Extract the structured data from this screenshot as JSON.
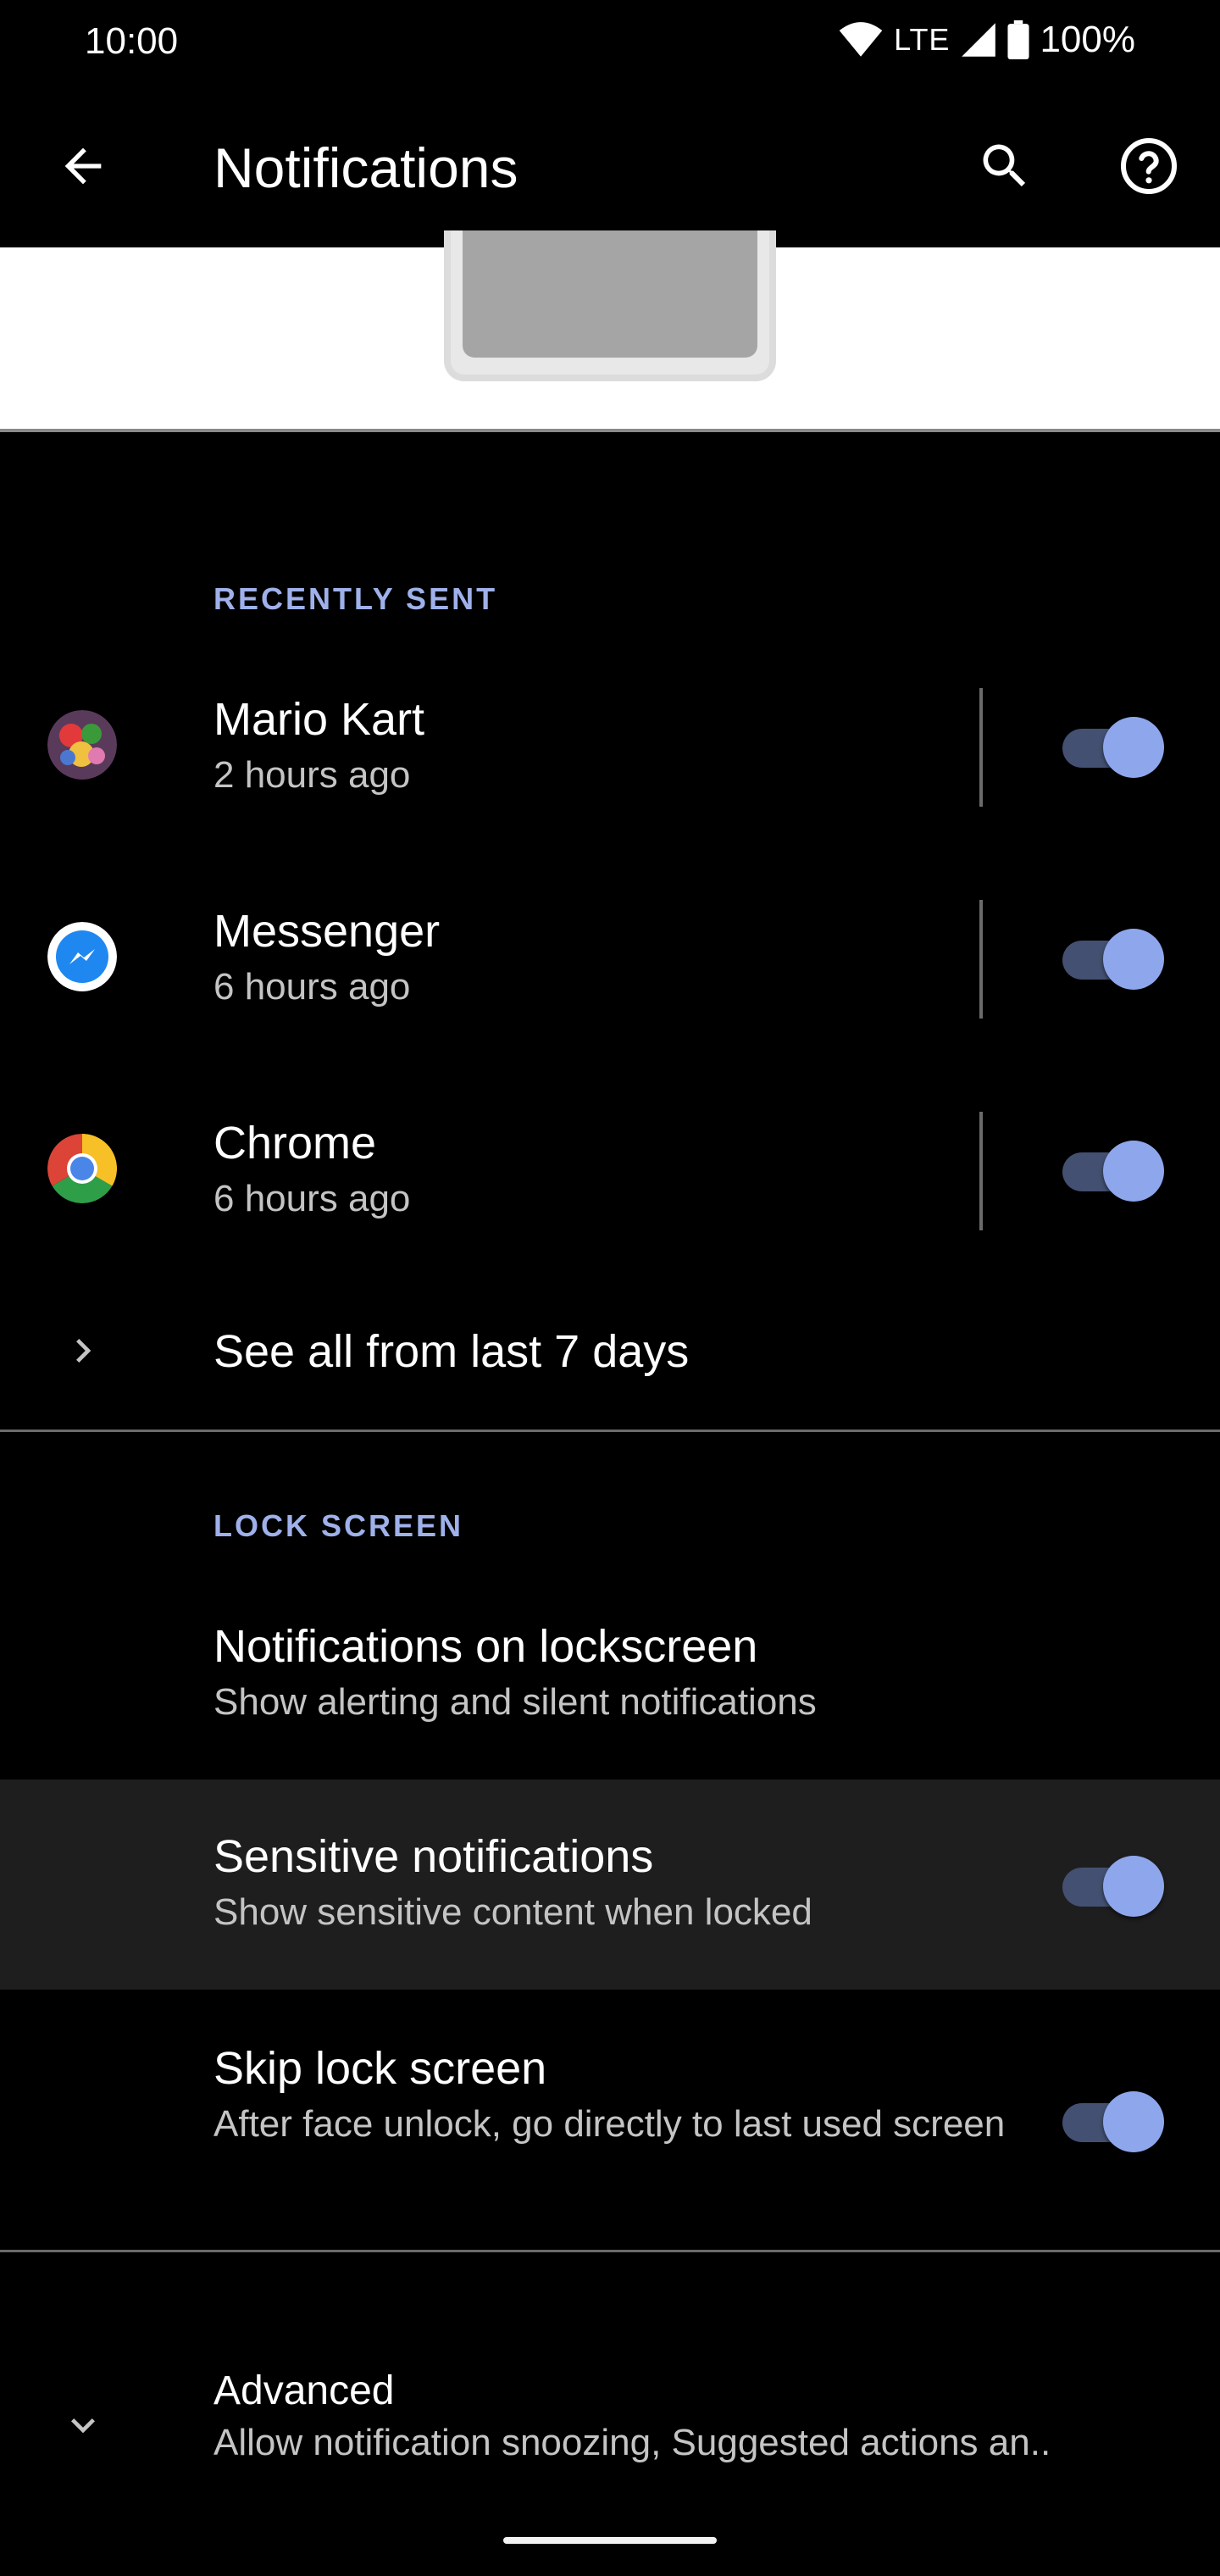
{
  "status_bar": {
    "time": "10:00",
    "network": "LTE",
    "battery": "100%"
  },
  "app_bar": {
    "title": "Notifications",
    "icons": [
      "back-arrow-icon",
      "search-icon",
      "help-icon"
    ]
  },
  "recently_sent": {
    "header": "RECENTLY SENT",
    "apps": [
      {
        "name": "Mario Kart",
        "time": "2 hours ago",
        "enabled": true,
        "icon": "mario-kart-icon"
      },
      {
        "name": "Messenger",
        "time": "6 hours ago",
        "enabled": true,
        "icon": "messenger-icon"
      },
      {
        "name": "Chrome",
        "time": "6 hours ago",
        "enabled": true,
        "icon": "chrome-icon"
      }
    ],
    "see_all": "See all from last 7 days"
  },
  "lock_screen": {
    "header": "LOCK SCREEN",
    "items": [
      {
        "title": "Notifications on lockscreen",
        "subtitle": "Show alerting and silent notifications"
      },
      {
        "title": "Sensitive notifications",
        "subtitle": "Show sensitive content when locked",
        "enabled": true
      },
      {
        "title": "Skip lock screen",
        "subtitle": "After face unlock, go directly to last used screen",
        "enabled": true
      }
    ]
  },
  "advanced": {
    "title": "Advanced",
    "subtitle": "Allow notification snoozing, Suggested actions an.."
  },
  "colors": {
    "accent": "#9fb1ea",
    "switch_thumb": "#8ea7ec",
    "switch_track": "#435071",
    "background": "#000000"
  }
}
